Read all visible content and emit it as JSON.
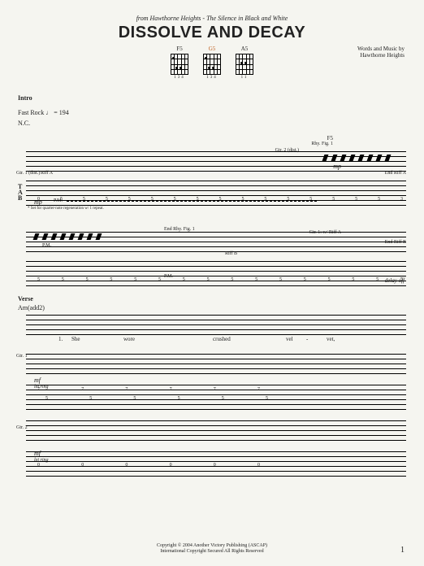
{
  "header": {
    "source_prefix": "from Hawthorne Heights - ",
    "album": "The Silence in Black and White",
    "title": "DISSOLVE AND DECAY",
    "credits_line1": "Words and Music by",
    "credits_line2": "Hawthorne Heights"
  },
  "chords": [
    {
      "name": "F5",
      "position": "134"
    },
    {
      "name": "G5",
      "position": "134",
      "highlight": true
    },
    {
      "name": "A5",
      "position": "11"
    }
  ],
  "intro": {
    "label": "Intro",
    "tempo": "Fast Rock ♩ = 194",
    "nc": "N.C."
  },
  "system1": {
    "gtr1": "Gtr. 1 (dist.)",
    "riffA": "Riff A",
    "chord_above": "F5",
    "rhyfig": "Rhy. Fig. 1",
    "gtr2": "Gtr. 2 (dist.)",
    "endRiffA": "End Riff A",
    "dyn": "mp",
    "dyn2": "mp",
    "pm": "P.M.",
    "tab_values": [
      "0",
      "5",
      "5",
      "5",
      "5",
      "5",
      "5",
      "5",
      "5",
      "5",
      "5",
      "5",
      "5",
      "5",
      "5",
      "5",
      "3"
    ],
    "tab2_lo": "3",
    "tab2_hi": "5",
    "footnote": "* Set for quarter-note regeneration w/ 1 repeat."
  },
  "system2": {
    "endRhy": "End Rhy. Fig. 1",
    "pm": "P.M.",
    "gtr1cont": "Gtr. 1: w/ Riff A",
    "endRiffB": "End Riff B",
    "riffB": "Riff B",
    "delay": "delay off",
    "tab_values": [
      "5",
      "5",
      "5",
      "5",
      "5",
      "5",
      "5",
      "5",
      "5",
      "5",
      "5",
      "5",
      "5",
      "5",
      "5",
      "5"
    ]
  },
  "verse": {
    "label": "Verse",
    "chord": "Am(add2)",
    "lyric_num": "1.",
    "lyrics": [
      "She",
      "wore",
      "crushed",
      "vel",
      "-",
      "vet,"
    ],
    "gtr1": "Gtr. 1",
    "gtr2": "Gtr. 2",
    "dyn": "mf",
    "letring": "let ring",
    "tab1": [
      "7",
      "7",
      "7",
      "7",
      "7",
      "7"
    ],
    "tab1b": [
      "5",
      "5",
      "5",
      "5",
      "5",
      "5"
    ],
    "tab2": [
      "0",
      "0",
      "0",
      "0",
      "0",
      "0"
    ]
  },
  "footer": {
    "line1": "Copyright © 2004 Another Victory Publishing (ASCAP)",
    "line2": "International Copyright Secured   All Rights Reserved",
    "page": "1"
  }
}
